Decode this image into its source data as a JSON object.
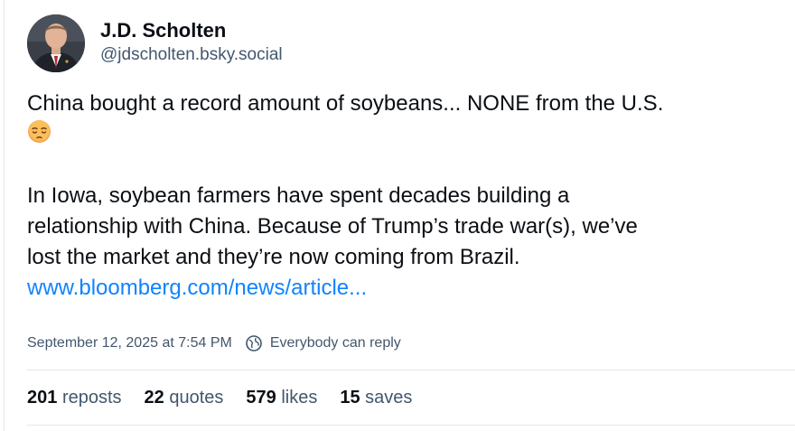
{
  "author": {
    "display_name": "J.D. Scholten",
    "handle": "@jdscholten.bsky.social",
    "avatar_icon": "person-portrait"
  },
  "post": {
    "line1": "China bought a record amount of soybeans... NONE from the U.S.",
    "emoji_icon": "pensive-face-emoji",
    "paragraph2": [
      "In Iowa, soybean farmers have spent decades building a",
      "relationship with China. Because of Trump’s trade war(s), we’ve",
      "lost the market and they’re now coming from Brazil."
    ],
    "link_text": "www.bloomberg.com/news/article..."
  },
  "meta": {
    "timestamp": "September 12, 2025 at 7:54 PM",
    "reply_setting": "Everybody can reply",
    "reply_icon": "globe-icon"
  },
  "stats": {
    "reposts": {
      "count": "201",
      "label": "reposts"
    },
    "quotes": {
      "count": "22",
      "label": "quotes"
    },
    "likes": {
      "count": "579",
      "label": "likes"
    },
    "saves": {
      "count": "15",
      "label": "saves"
    }
  },
  "colors": {
    "link": "#1083fe",
    "muted": "#42576c",
    "text": "#0b0f14",
    "divider": "#e3e8ee"
  }
}
